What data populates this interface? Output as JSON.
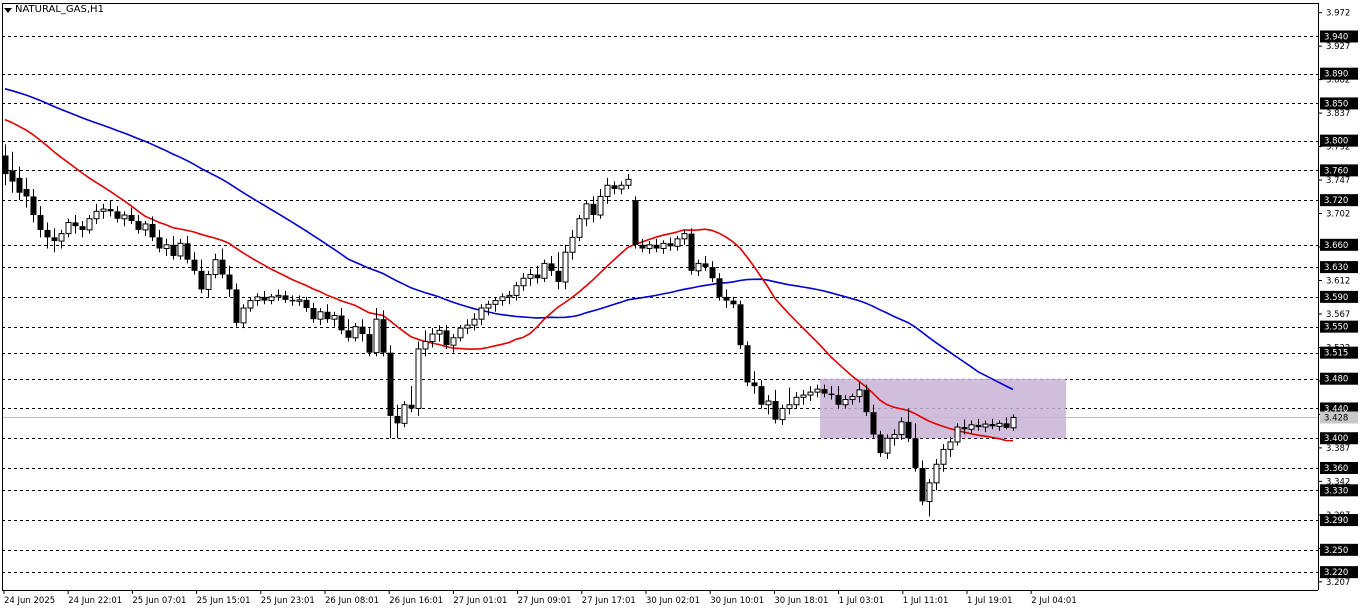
{
  "window": {
    "title": "NATURAL_GAS,H1"
  },
  "colors": {
    "ma_fast": "#e00000",
    "ma_slow": "#0000d0",
    "zone_fill": "#c9b1d6",
    "level_label_bg": "#000000",
    "current_label_bg": "#c8c8c8",
    "grid": "#000000"
  },
  "chart_data": {
    "type": "candlestick",
    "symbol": "NATURAL_GAS",
    "timeframe": "H1",
    "ylim": [
      3.196,
      3.985
    ],
    "price_ticks": [
      "3.972",
      "3.927",
      "3.882",
      "3.837",
      "3.792",
      "3.747",
      "3.702",
      "3.657",
      "3.612",
      "3.567",
      "3.522",
      "3.477",
      "3.432",
      "3.387",
      "3.342",
      "3.297",
      "3.252",
      "3.207"
    ],
    "levels": [
      "3.940",
      "3.890",
      "3.850",
      "3.800",
      "3.760",
      "3.720",
      "3.660",
      "3.630",
      "3.590",
      "3.550",
      "3.515",
      "3.480",
      "3.440",
      "3.400",
      "3.360",
      "3.330",
      "3.290",
      "3.250",
      "3.220"
    ],
    "current_price": "3.428",
    "time_labels": [
      "24 Jun 2025",
      "24 Jun 22:01",
      "25 Jun 07:01",
      "25 Jun 15:01",
      "25 Jun 23:01",
      "26 Jun 08:01",
      "26 Jun 16:01",
      "27 Jun 01:01",
      "27 Jun 09:01",
      "27 Jun 17:01",
      "30 Jun 02:01",
      "30 Jun 10:01",
      "30 Jun 18:01",
      "1 Jul 03:01",
      "1 Jul 11:01",
      "1 Jul 19:01",
      "2 Jul 04:01"
    ],
    "zone": {
      "bar_start": 117,
      "bar_end": 151,
      "price_low": 3.4,
      "price_high": 3.48
    },
    "candles": [
      [
        3.78,
        3.795,
        3.74,
        3.755
      ],
      [
        3.76,
        3.785,
        3.73,
        3.745
      ],
      [
        3.75,
        3.765,
        3.72,
        3.73
      ],
      [
        3.735,
        3.75,
        3.71,
        3.725
      ],
      [
        3.725,
        3.735,
        3.69,
        3.7
      ],
      [
        3.7,
        3.712,
        3.67,
        3.68
      ],
      [
        3.68,
        3.69,
        3.655,
        3.67
      ],
      [
        3.67,
        3.682,
        3.65,
        3.665
      ],
      [
        3.665,
        3.68,
        3.655,
        3.675
      ],
      [
        3.675,
        3.695,
        3.67,
        3.69
      ],
      [
        3.69,
        3.7,
        3.675,
        3.685
      ],
      [
        3.685,
        3.692,
        3.67,
        3.68
      ],
      [
        3.68,
        3.7,
        3.675,
        3.695
      ],
      [
        3.695,
        3.715,
        3.688,
        3.705
      ],
      [
        3.705,
        3.715,
        3.695,
        3.708
      ],
      [
        3.708,
        3.72,
        3.698,
        3.705
      ],
      [
        3.705,
        3.712,
        3.69,
        3.695
      ],
      [
        3.695,
        3.705,
        3.685,
        3.7
      ],
      [
        3.7,
        3.71,
        3.688,
        3.692
      ],
      [
        3.692,
        3.7,
        3.675,
        3.68
      ],
      [
        3.68,
        3.692,
        3.672,
        3.688
      ],
      [
        3.688,
        3.698,
        3.665,
        3.67
      ],
      [
        3.67,
        3.68,
        3.65,
        3.655
      ],
      [
        3.655,
        3.668,
        3.645,
        3.66
      ],
      [
        3.66,
        3.672,
        3.64,
        3.645
      ],
      [
        3.645,
        3.668,
        3.64,
        3.662
      ],
      [
        3.662,
        3.672,
        3.635,
        3.64
      ],
      [
        3.64,
        3.65,
        3.62,
        3.625
      ],
      [
        3.625,
        3.64,
        3.595,
        3.6
      ],
      [
        3.6,
        3.625,
        3.59,
        3.62
      ],
      [
        3.62,
        3.648,
        3.615,
        3.64
      ],
      [
        3.64,
        3.655,
        3.615,
        3.62
      ],
      [
        3.62,
        3.632,
        3.59,
        3.6
      ],
      [
        3.6,
        3.608,
        3.55,
        3.555
      ],
      [
        3.555,
        3.58,
        3.548,
        3.575
      ],
      [
        3.575,
        3.59,
        3.57,
        3.585
      ],
      [
        3.585,
        3.595,
        3.578,
        3.59
      ],
      [
        3.59,
        3.598,
        3.58,
        3.585
      ],
      [
        3.585,
        3.594,
        3.58,
        3.59
      ],
      [
        3.59,
        3.6,
        3.585,
        3.592
      ],
      [
        3.592,
        3.598,
        3.582,
        3.586
      ],
      [
        3.586,
        3.592,
        3.578,
        3.584
      ],
      [
        3.584,
        3.592,
        3.578,
        3.586
      ],
      [
        3.586,
        3.59,
        3.57,
        3.575
      ],
      [
        3.575,
        3.582,
        3.555,
        3.56
      ],
      [
        3.56,
        3.575,
        3.552,
        3.57
      ],
      [
        3.57,
        3.58,
        3.555,
        3.56
      ],
      [
        3.56,
        3.57,
        3.55,
        3.565
      ],
      [
        3.565,
        3.575,
        3.54,
        3.545
      ],
      [
        3.545,
        3.56,
        3.53,
        3.535
      ],
      [
        3.535,
        3.555,
        3.53,
        3.55
      ],
      [
        3.55,
        3.56,
        3.53,
        3.54
      ],
      [
        3.54,
        3.548,
        3.51,
        3.515
      ],
      [
        3.515,
        3.575,
        3.51,
        3.56
      ],
      [
        3.56,
        3.572,
        3.51,
        3.515
      ],
      [
        3.515,
        3.525,
        3.4,
        3.43
      ],
      [
        3.43,
        3.445,
        3.4,
        3.42
      ],
      [
        3.42,
        3.45,
        3.415,
        3.445
      ],
      [
        3.445,
        3.47,
        3.435,
        3.44
      ],
      [
        3.44,
        3.53,
        3.43,
        3.52
      ],
      [
        3.52,
        3.545,
        3.51,
        3.53
      ],
      [
        3.53,
        3.548,
        3.522,
        3.54
      ],
      [
        3.54,
        3.552,
        3.53,
        3.545
      ],
      [
        3.545,
        3.552,
        3.52,
        3.525
      ],
      [
        3.525,
        3.54,
        3.515,
        3.535
      ],
      [
        3.535,
        3.552,
        3.53,
        3.548
      ],
      [
        3.548,
        3.56,
        3.54,
        3.552
      ],
      [
        3.552,
        3.568,
        3.545,
        3.56
      ],
      [
        3.56,
        3.58,
        3.552,
        3.575
      ],
      [
        3.575,
        3.585,
        3.565,
        3.58
      ],
      [
        3.58,
        3.59,
        3.57,
        3.585
      ],
      [
        3.585,
        3.595,
        3.578,
        3.59
      ],
      [
        3.59,
        3.598,
        3.58,
        3.592
      ],
      [
        3.592,
        3.61,
        3.585,
        3.605
      ],
      [
        3.605,
        3.622,
        3.598,
        3.615
      ],
      [
        3.615,
        3.628,
        3.605,
        3.62
      ],
      [
        3.62,
        3.632,
        3.608,
        3.615
      ],
      [
        3.615,
        3.64,
        3.61,
        3.635
      ],
      [
        3.635,
        3.645,
        3.618,
        3.625
      ],
      [
        3.625,
        3.65,
        3.6,
        3.61
      ],
      [
        3.61,
        3.66,
        3.6,
        3.65
      ],
      [
        3.65,
        3.68,
        3.64,
        3.67
      ],
      [
        3.67,
        3.7,
        3.665,
        3.695
      ],
      [
        3.695,
        3.72,
        3.685,
        3.715
      ],
      [
        3.715,
        3.725,
        3.69,
        3.7
      ],
      [
        3.7,
        3.735,
        3.695,
        3.725
      ],
      [
        3.725,
        3.75,
        3.715,
        3.74
      ],
      [
        3.74,
        3.745,
        3.728,
        3.735
      ],
      [
        3.735,
        3.745,
        3.728,
        3.74
      ],
      [
        3.74,
        3.755,
        3.735,
        3.748
      ],
      [
        3.72,
        3.725,
        3.655,
        3.66
      ],
      [
        3.66,
        3.668,
        3.65,
        3.655
      ],
      [
        3.655,
        3.665,
        3.648,
        3.66
      ],
      [
        3.66,
        3.668,
        3.65,
        3.655
      ],
      [
        3.655,
        3.666,
        3.648,
        3.662
      ],
      [
        3.662,
        3.67,
        3.652,
        3.658
      ],
      [
        3.658,
        3.672,
        3.652,
        3.668
      ],
      [
        3.668,
        3.68,
        3.66,
        3.675
      ],
      [
        3.675,
        3.682,
        3.62,
        3.625
      ],
      [
        3.625,
        3.64,
        3.618,
        3.635
      ],
      [
        3.635,
        3.645,
        3.625,
        3.63
      ],
      [
        3.63,
        3.638,
        3.61,
        3.615
      ],
      [
        3.615,
        3.622,
        3.585,
        3.59
      ],
      [
        3.59,
        3.6,
        3.575,
        3.585
      ],
      [
        3.585,
        3.59,
        3.575,
        3.58
      ],
      [
        3.58,
        3.585,
        3.52,
        3.525
      ],
      [
        3.525,
        3.53,
        3.47,
        3.475
      ],
      [
        3.475,
        3.49,
        3.46,
        3.47
      ],
      [
        3.47,
        3.478,
        3.44,
        3.445
      ],
      [
        3.445,
        3.458,
        3.432,
        3.45
      ],
      [
        3.45,
        3.465,
        3.42,
        3.425
      ],
      [
        3.425,
        3.445,
        3.418,
        3.44
      ],
      [
        3.44,
        3.468,
        3.432,
        3.445
      ],
      [
        3.445,
        3.462,
        3.44,
        3.455
      ],
      [
        3.455,
        3.465,
        3.445,
        3.458
      ],
      [
        3.458,
        3.47,
        3.45,
        3.462
      ],
      [
        3.462,
        3.472,
        3.455,
        3.466
      ],
      [
        3.466,
        3.472,
        3.455,
        3.46
      ],
      [
        3.46,
        3.47,
        3.452,
        3.458
      ],
      [
        3.458,
        3.47,
        3.44,
        3.445
      ],
      [
        3.445,
        3.458,
        3.44,
        3.452
      ],
      [
        3.452,
        3.46,
        3.445,
        3.456
      ],
      [
        3.456,
        3.475,
        3.448,
        3.465
      ],
      [
        3.465,
        3.472,
        3.43,
        3.435
      ],
      [
        3.435,
        3.445,
        3.4,
        3.405
      ],
      [
        3.405,
        3.41,
        3.375,
        3.38
      ],
      [
        3.38,
        3.405,
        3.372,
        3.4
      ],
      [
        3.4,
        3.412,
        3.39,
        3.405
      ],
      [
        3.405,
        3.428,
        3.398,
        3.422
      ],
      [
        3.422,
        3.44,
        3.395,
        3.4
      ],
      [
        3.4,
        3.42,
        3.355,
        3.36
      ],
      [
        3.36,
        3.37,
        3.31,
        3.315
      ],
      [
        3.315,
        3.345,
        3.295,
        3.34
      ],
      [
        3.34,
        3.372,
        3.33,
        3.365
      ],
      [
        3.365,
        3.392,
        3.355,
        3.385
      ],
      [
        3.385,
        3.402,
        3.375,
        3.395
      ],
      [
        3.395,
        3.42,
        3.39,
        3.415
      ],
      [
        3.415,
        3.425,
        3.405,
        3.412
      ],
      [
        3.412,
        3.424,
        3.406,
        3.418
      ],
      [
        3.418,
        3.426,
        3.41,
        3.415
      ],
      [
        3.415,
        3.424,
        3.408,
        3.419
      ],
      [
        3.419,
        3.426,
        3.412,
        3.416
      ],
      [
        3.416,
        3.424,
        3.41,
        3.42
      ],
      [
        3.42,
        3.428,
        3.412,
        3.414
      ],
      [
        3.414,
        3.432,
        3.41,
        3.428
      ]
    ]
  }
}
